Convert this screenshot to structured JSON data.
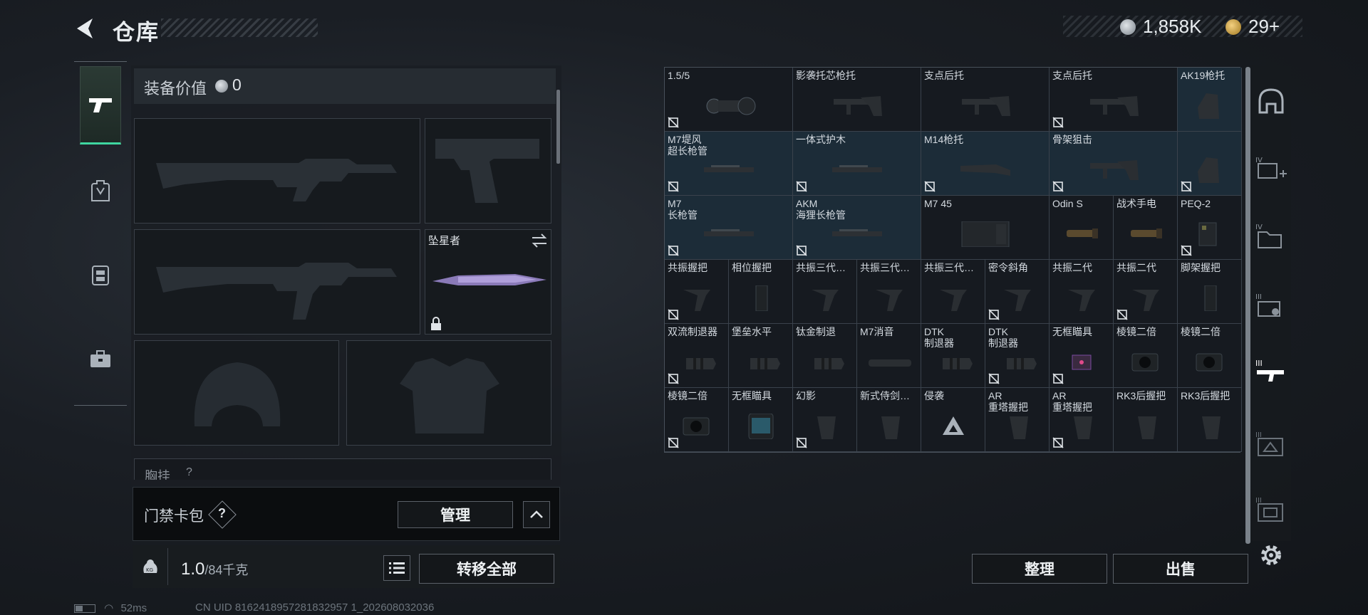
{
  "header": {
    "title": "仓库",
    "currency_silver": "1,858K",
    "currency_gold": "29+"
  },
  "left_nav": {
    "items": [
      {
        "icon": "pistol-icon",
        "active": true
      },
      {
        "icon": "backpack-icon",
        "active": false
      },
      {
        "icon": "vest-icon",
        "active": false
      },
      {
        "icon": "toolbox-icon",
        "active": false
      }
    ]
  },
  "equipment": {
    "value_label": "装备价值",
    "value": "0",
    "melee_name": "坠星者",
    "chest_label": "胸挂",
    "chest_q": "?"
  },
  "card_bar": {
    "label": "门禁卡包",
    "help": "?",
    "manage": "管理"
  },
  "bottom": {
    "kg_label": "KG",
    "weight": "1.0",
    "weight_max": "/84千克",
    "transfer_all": "转移全部",
    "sort": "整理",
    "sell": "出售"
  },
  "status": {
    "ping": "52ms",
    "uid": "CN UID 8162418957281832957 1_202608032036"
  },
  "grid": {
    "rows": [
      [
        {
          "label": "1.5/5",
          "color": "dark",
          "art": "scope",
          "flag": true
        },
        {
          "label": "影袭托芯枪托",
          "color": "dark",
          "art": "stock",
          "flag": false
        },
        {
          "label": "支点后托",
          "color": "dark",
          "art": "stock",
          "flag": false
        },
        {
          "label": "支点后托",
          "color": "dark",
          "art": "stock",
          "flag": true
        },
        {
          "label": "AK19枪托",
          "color": "blue",
          "art": "stock-v",
          "flag": false
        }
      ],
      [
        {
          "label": "M7堤风\n超长枪管",
          "color": "blue",
          "art": "barrel",
          "flag": true
        },
        {
          "label": "一体式护木",
          "color": "blue",
          "art": "barrel",
          "flag": true
        },
        {
          "label": "M14枪托",
          "color": "blue",
          "art": "rifle-stock",
          "flag": true
        },
        {
          "label": "骨架狙击",
          "color": "blue",
          "art": "stock",
          "flag": true
        },
        {
          "label": "",
          "color": "blue",
          "art": "stock-v",
          "flag": true
        }
      ],
      [
        {
          "label": "M7\n长枪管",
          "color": "blue",
          "art": "barrel",
          "flag": true
        },
        {
          "label": "AKM\n海狸长枪管",
          "color": "blue",
          "art": "barrel",
          "flag": true
        },
        {
          "label": "M7 45",
          "color": "dark",
          "art": "mag",
          "flag": false
        },
        {
          "label": "Odin S",
          "color": "dark",
          "art": "light",
          "flag": false
        },
        {
          "label": "战术手电",
          "color": "dark",
          "art": "light",
          "flag": false
        },
        {
          "label": "PEQ-2",
          "color": "dark",
          "art": "laser",
          "flag": true
        }
      ],
      [
        {
          "label": "共振握把",
          "color": "dark",
          "art": "grip",
          "flag": true
        },
        {
          "label": "相位握把",
          "color": "dark",
          "art": "grip-v",
          "flag": false
        },
        {
          "label": "共振三代…",
          "color": "dark",
          "art": "grip",
          "flag": false
        },
        {
          "label": "共振三代…",
          "color": "dark",
          "art": "grip",
          "flag": false
        },
        {
          "label": "共振三代…",
          "color": "dark",
          "art": "grip",
          "flag": false
        },
        {
          "label": "密令斜角",
          "color": "dark",
          "art": "grip",
          "flag": true
        },
        {
          "label": "共振二代",
          "color": "dark",
          "art": "grip",
          "flag": false
        },
        {
          "label": "共振二代",
          "color": "dark",
          "art": "grip",
          "flag": true
        },
        {
          "label": "脚架握把",
          "color": "dark",
          "art": "grip-v",
          "flag": false
        }
      ],
      [
        {
          "label": "双流制退器",
          "color": "dark",
          "art": "muzzle",
          "flag": true
        },
        {
          "label": "堡垒水平",
          "color": "dark",
          "art": "muzzle",
          "flag": false
        },
        {
          "label": "钛金制退",
          "color": "dark",
          "art": "muzzle",
          "flag": false
        },
        {
          "label": "M7消音",
          "color": "dark",
          "art": "suppressor",
          "flag": false
        },
        {
          "label": "DTK\n制退器",
          "color": "dark",
          "art": "muzzle",
          "flag": false
        },
        {
          "label": "DTK\n制退器",
          "color": "dark",
          "art": "muzzle",
          "flag": true
        },
        {
          "label": "无框瞄具",
          "color": "dark",
          "art": "red-dot",
          "flag": true
        },
        {
          "label": "棱镜二倍",
          "color": "dark",
          "art": "optic",
          "flag": false
        },
        {
          "label": "棱镜二倍",
          "color": "dark",
          "art": "optic",
          "flag": false
        }
      ],
      [
        {
          "label": "棱镜二倍",
          "color": "dark",
          "art": "optic",
          "flag": true
        },
        {
          "label": "无框瞄具",
          "color": "dark",
          "art": "holo",
          "flag": false
        },
        {
          "label": "幻影",
          "color": "dark",
          "art": "pistol-grip",
          "flag": true
        },
        {
          "label": "新式侍剑…",
          "color": "dark",
          "art": "pistol-grip",
          "flag": false
        },
        {
          "label": "侵袭",
          "color": "dark",
          "art": "triangle",
          "flag": false
        },
        {
          "label": "AR\n重塔握把",
          "color": "dark",
          "art": "pistol-grip",
          "flag": false
        },
        {
          "label": "AR\n重塔握把",
          "color": "dark",
          "art": "pistol-grip",
          "flag": true
        },
        {
          "label": "RK3后握把",
          "color": "dark",
          "art": "pistol-grip",
          "flag": false
        },
        {
          "label": "RK3后握把",
          "color": "dark",
          "art": "pistol-grip",
          "flag": false
        }
      ]
    ]
  },
  "right_nav": {
    "items": [
      {
        "icon": "helmet-icon"
      },
      {
        "icon": "armor-plus-icon"
      },
      {
        "icon": "folder-icon"
      },
      {
        "icon": "ammo-icon"
      },
      {
        "icon": "rifle-parts-icon"
      },
      {
        "icon": "crate-icon"
      },
      {
        "icon": "box-icon"
      }
    ],
    "settings": "gear-icon"
  }
}
